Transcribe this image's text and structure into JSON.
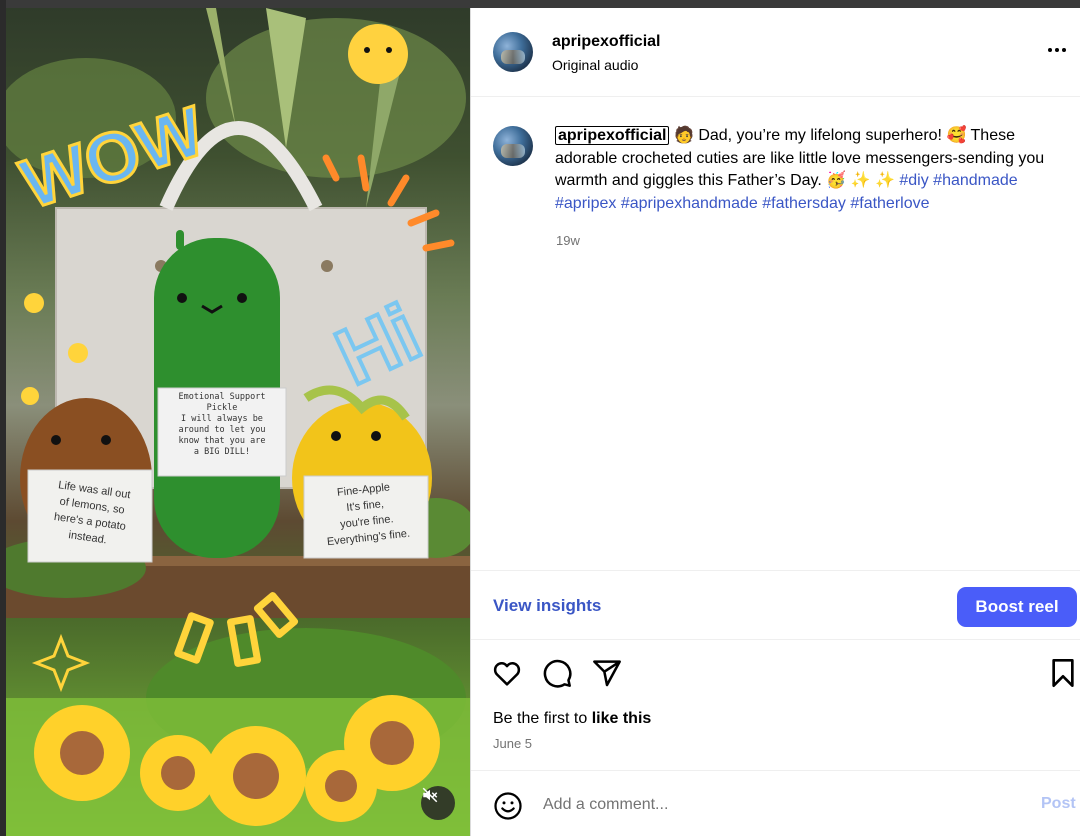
{
  "post": {
    "username": "apripexofficial",
    "audio_label": "Original audio",
    "more_icon": "more-options-icon"
  },
  "caption": {
    "username": "apripexofficial",
    "text": "Dad, you’re my lifelong superhero!",
    "text2": "These adorable crocheted cuties are like little love messengers-sending you warmth and giggles this Father’s Day.",
    "hashtags": [
      "#diy",
      "#handmade",
      "#apripex",
      "#apripexhandmade",
      "#fathersday",
      "#fatherlove"
    ],
    "time_ago": "19w"
  },
  "media": {
    "sticker_wow": "WOW",
    "sticker_hi": "Hi",
    "card_pickle": [
      "Emotional Support",
      "Pickle",
      "I will always be",
      "around to let you",
      "know that you are",
      "a BIG DILL!"
    ],
    "card_potato": [
      "Life was all out",
      "of lemons, so",
      "here's a potato",
      "instead."
    ],
    "card_pineapple": [
      "Fine-Apple",
      "It's fine,",
      "you're fine.",
      "Everything's fine."
    ],
    "mute_icon": "muted-speaker-icon"
  },
  "insights": {
    "view_label": "View insights",
    "boost_label": "Boost reel"
  },
  "engagement": {
    "like_prefix": "Be the first to ",
    "like_action": "like this",
    "date": "June 5"
  },
  "comment": {
    "placeholder": "Add a comment...",
    "post_label": "Post"
  },
  "colors": {
    "link_blue": "#3a56c5",
    "boost_blue": "#4a5df9",
    "post_disabled": "#b3c4f5",
    "muted_gray": "#737373"
  }
}
